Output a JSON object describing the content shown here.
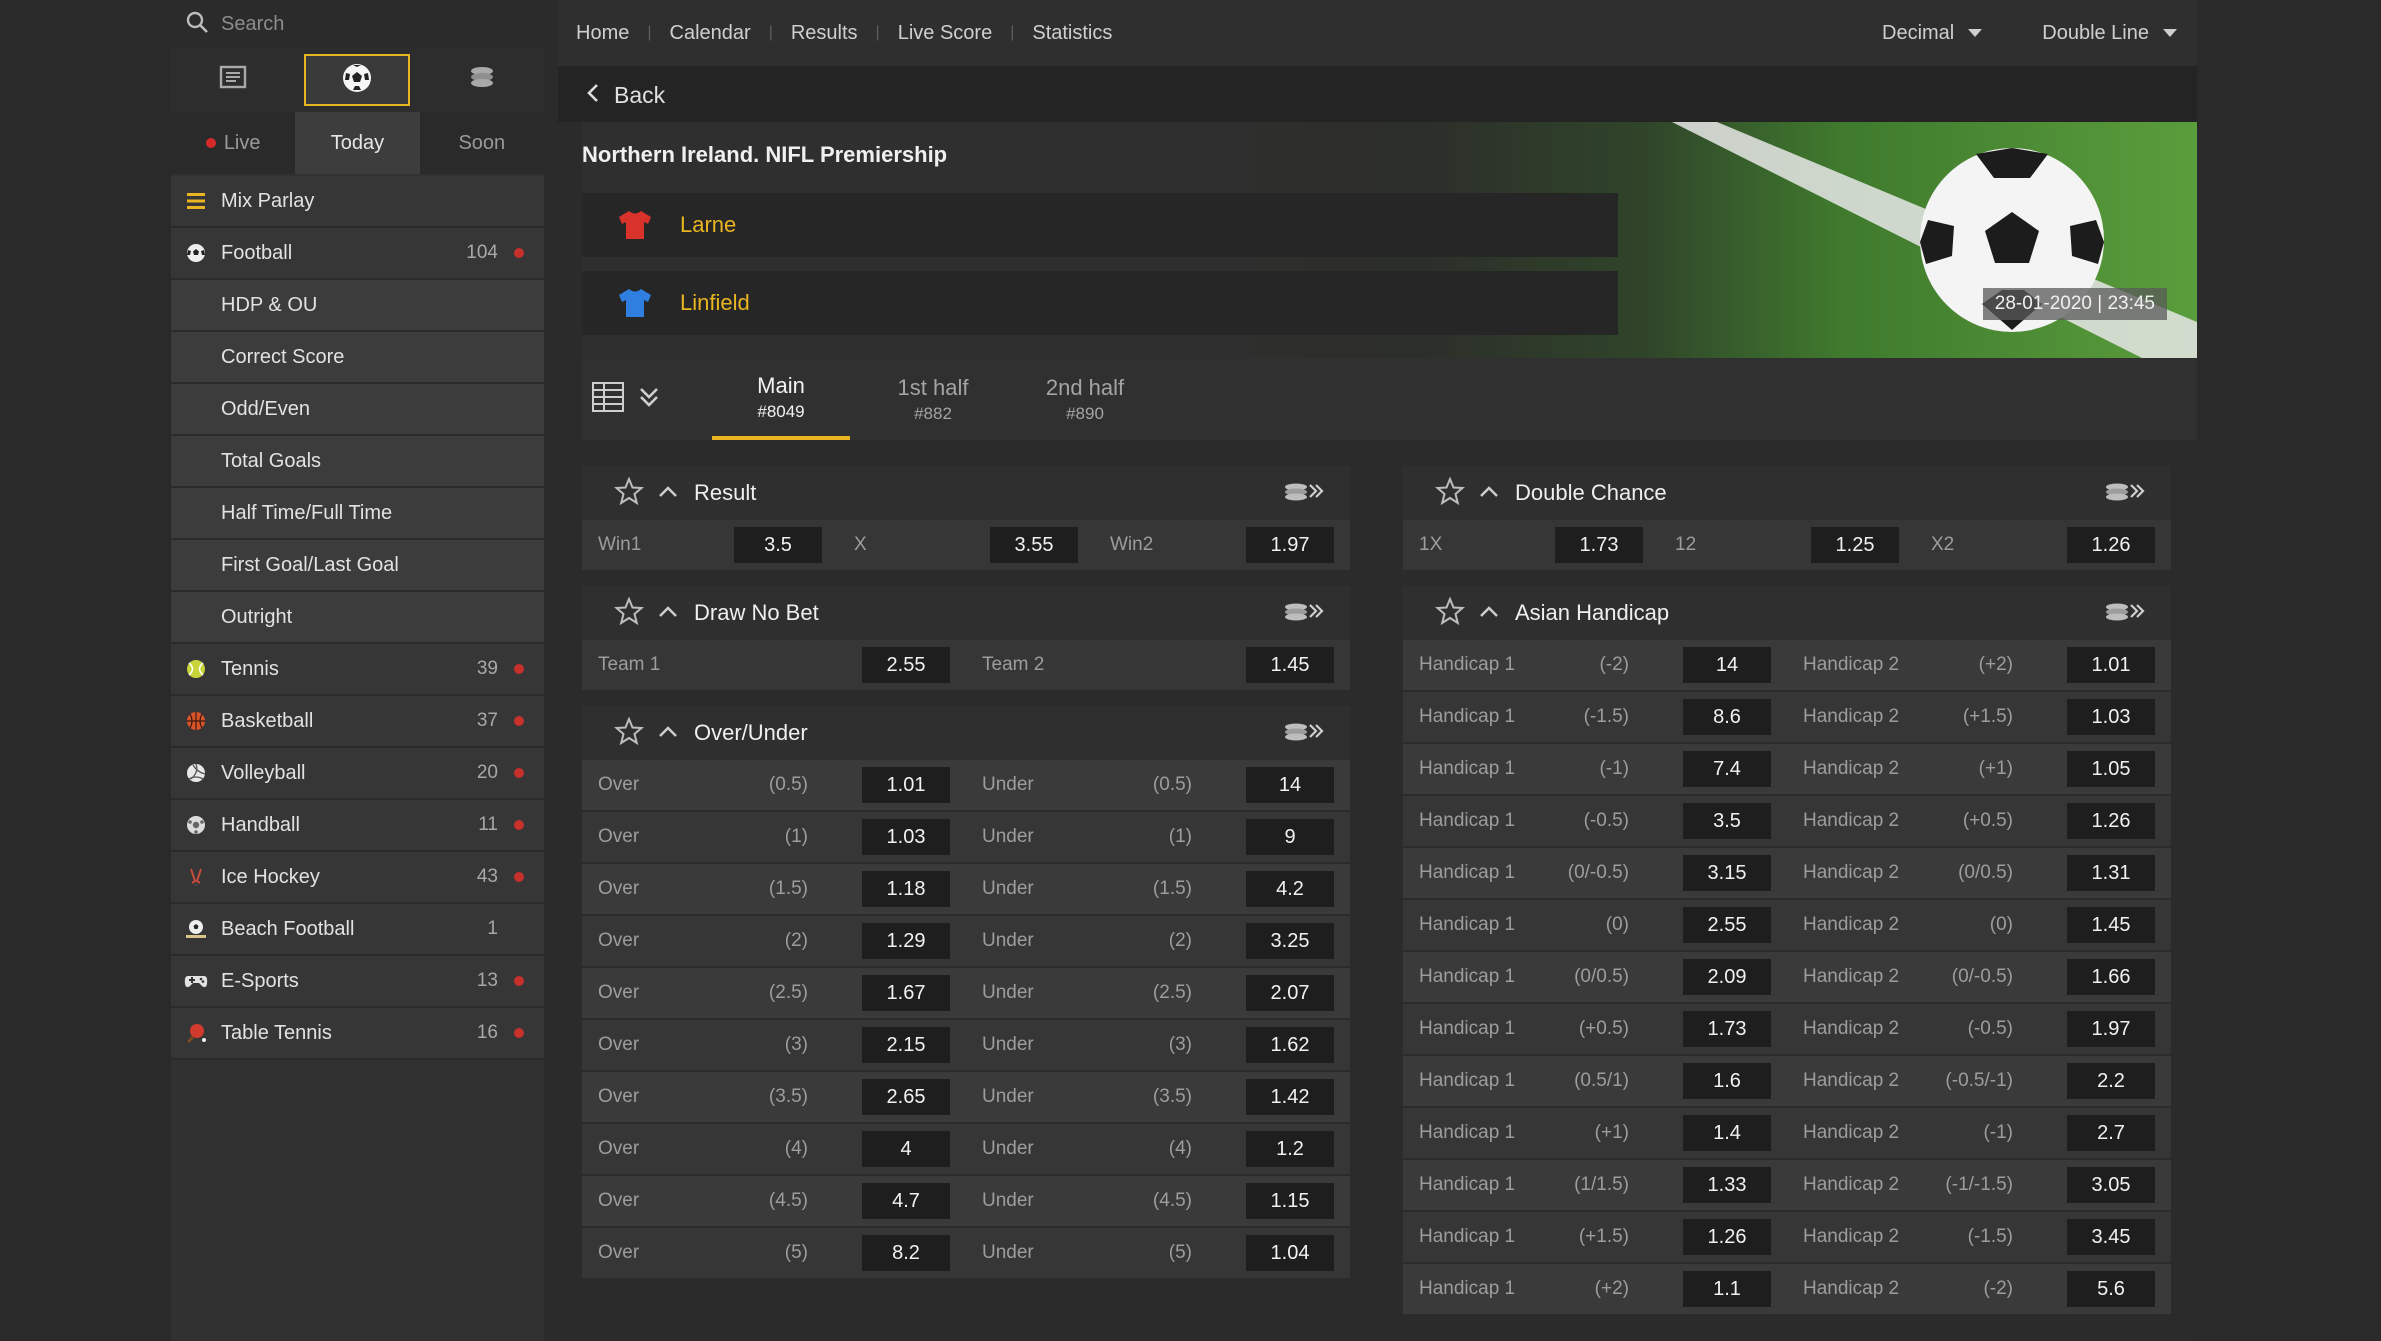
{
  "search": {
    "placeholder": "Search"
  },
  "sidebar": {
    "time_tabs": [
      {
        "label": "Live"
      },
      {
        "label": "Today"
      },
      {
        "label": "Soon"
      }
    ],
    "items": [
      {
        "label": "Mix Parlay",
        "count": "",
        "icon": "list-icon"
      },
      {
        "label": "Football",
        "count": "104",
        "icon": "football-icon"
      },
      {
        "label": "HDP & OU",
        "sub": true
      },
      {
        "label": "Correct Score",
        "sub": true
      },
      {
        "label": "Odd/Even",
        "sub": true
      },
      {
        "label": "Total Goals",
        "sub": true
      },
      {
        "label": "Half Time/Full Time",
        "sub": true
      },
      {
        "label": "First Goal/Last Goal",
        "sub": true
      },
      {
        "label": "Outright",
        "sub": true
      },
      {
        "label": "Tennis",
        "count": "39",
        "icon": "tennis-icon"
      },
      {
        "label": "Basketball",
        "count": "37",
        "icon": "basketball-icon"
      },
      {
        "label": "Volleyball",
        "count": "20",
        "icon": "volleyball-icon"
      },
      {
        "label": "Handball",
        "count": "11",
        "icon": "handball-icon"
      },
      {
        "label": "Ice Hockey",
        "count": "43",
        "icon": "ice-hockey-icon"
      },
      {
        "label": "Beach Football",
        "count": "1",
        "icon": "beach-football-icon"
      },
      {
        "label": "E-Sports",
        "count": "13",
        "icon": "gamepad-icon"
      },
      {
        "label": "Table Tennis",
        "count": "16",
        "icon": "table-tennis-icon"
      }
    ]
  },
  "nav": {
    "links": [
      "Home",
      "Calendar",
      "Results",
      "Live Score",
      "Statistics"
    ],
    "odds_format": "Decimal",
    "line_mode": "Double Line"
  },
  "back": {
    "label": "Back"
  },
  "event": {
    "league": "Northern Ireland. NIFL Premiership",
    "home": "Larne",
    "away": "Linfield",
    "datetime": "28-01-2020 | 23:45"
  },
  "market_tabs": [
    {
      "label": "Main",
      "num": "#8049"
    },
    {
      "label": "1st half",
      "num": "#882"
    },
    {
      "label": "2nd half",
      "num": "#890"
    }
  ],
  "markets": {
    "result": {
      "title": "Result",
      "win1": "Win1",
      "win1_odd": "3.5",
      "x": "X",
      "x_odd": "3.55",
      "win2": "Win2",
      "win2_odd": "1.97"
    },
    "double_chance": {
      "title": "Double Chance",
      "a": "1X",
      "a_odd": "1.73",
      "b": "12",
      "b_odd": "1.25",
      "c": "X2",
      "c_odd": "1.26"
    },
    "draw_no_bet": {
      "title": "Draw No Bet",
      "t1": "Team 1",
      "t1_odd": "2.55",
      "t2": "Team 2",
      "t2_odd": "1.45"
    },
    "over_under": {
      "title": "Over/Under",
      "over_label": "Over",
      "under_label": "Under",
      "rows": [
        {
          "line": "(0.5)",
          "over": "1.01",
          "under": "14"
        },
        {
          "line": "(1)",
          "over": "1.03",
          "under": "9"
        },
        {
          "line": "(1.5)",
          "over": "1.18",
          "under": "4.2"
        },
        {
          "line": "(2)",
          "over": "1.29",
          "under": "3.25"
        },
        {
          "line": "(2.5)",
          "over": "1.67",
          "under": "2.07"
        },
        {
          "line": "(3)",
          "over": "2.15",
          "under": "1.62"
        },
        {
          "line": "(3.5)",
          "over": "2.65",
          "under": "1.42"
        },
        {
          "line": "(4)",
          "over": "4",
          "under": "1.2"
        },
        {
          "line": "(4.5)",
          "over": "4.7",
          "under": "1.15"
        },
        {
          "line": "(5)",
          "over": "8.2",
          "under": "1.04"
        }
      ]
    },
    "asian_handicap": {
      "title": "Asian Handicap",
      "h1_label": "Handicap 1",
      "h2_label": "Handicap 2",
      "rows": [
        {
          "l1": "(-2)",
          "o1": "14",
          "l2": "(+2)",
          "o2": "1.01"
        },
        {
          "l1": "(-1.5)",
          "o1": "8.6",
          "l2": "(+1.5)",
          "o2": "1.03"
        },
        {
          "l1": "(-1)",
          "o1": "7.4",
          "l2": "(+1)",
          "o2": "1.05"
        },
        {
          "l1": "(-0.5)",
          "o1": "3.5",
          "l2": "(+0.5)",
          "o2": "1.26"
        },
        {
          "l1": "(0/-0.5)",
          "o1": "3.15",
          "l2": "(0/0.5)",
          "o2": "1.31"
        },
        {
          "l1": "(0)",
          "o1": "2.55",
          "l2": "(0)",
          "o2": "1.45"
        },
        {
          "l1": "(0/0.5)",
          "o1": "2.09",
          "l2": "(0/-0.5)",
          "o2": "1.66"
        },
        {
          "l1": "(+0.5)",
          "o1": "1.73",
          "l2": "(-0.5)",
          "o2": "1.97"
        },
        {
          "l1": "(0.5/1)",
          "o1": "1.6",
          "l2": "(-0.5/-1)",
          "o2": "2.2"
        },
        {
          "l1": "(+1)",
          "o1": "1.4",
          "l2": "(-1)",
          "o2": "2.7"
        },
        {
          "l1": "(1/1.5)",
          "o1": "1.33",
          "l2": "(-1/-1.5)",
          "o2": "3.05"
        },
        {
          "l1": "(+1.5)",
          "o1": "1.26",
          "l2": "(-1.5)",
          "o2": "3.45"
        },
        {
          "l1": "(+2)",
          "o1": "1.1",
          "l2": "(-2)",
          "o2": "5.6"
        }
      ]
    }
  },
  "colors": {
    "accent": "#e9b521",
    "live": "#d62a2a",
    "home_shirt": "#d8322b",
    "away_shirt": "#2f7fe0"
  }
}
